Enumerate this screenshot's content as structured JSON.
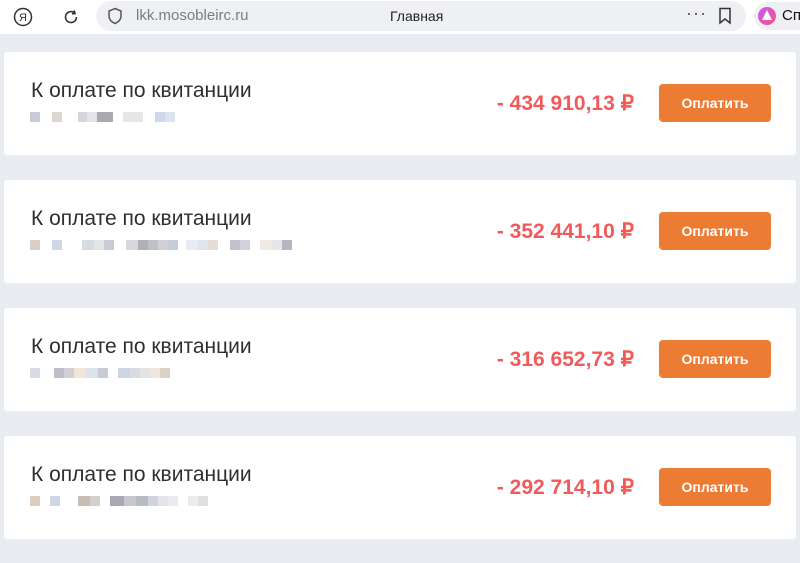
{
  "browser": {
    "url": "lkk.mosobleirc.ru",
    "tab_title": "Главная",
    "more_label": "···",
    "alice_label": "Сп"
  },
  "invoices": [
    {
      "title": "К оплате по квитанции",
      "amount": "- 434 910,13 ₽",
      "pay_label": "Оплатить"
    },
    {
      "title": "К оплате по квитанции",
      "amount": "- 352 441,10 ₽",
      "pay_label": "Оплатить"
    },
    {
      "title": "К оплате по квитанции",
      "amount": "- 316 652,73 ₽",
      "pay_label": "Оплатить"
    },
    {
      "title": "К оплате по квитанции",
      "amount": "- 292 714,10 ₽",
      "pay_label": "Оплатить"
    }
  ],
  "colors": {
    "amount": "#f05a5a",
    "pay_button": "#ec7b33",
    "page_background": "#e9ecf1"
  },
  "icons": [
    "yandex-logo-icon",
    "reload-icon",
    "shield-icon",
    "bookmark-icon",
    "alice-icon"
  ]
}
